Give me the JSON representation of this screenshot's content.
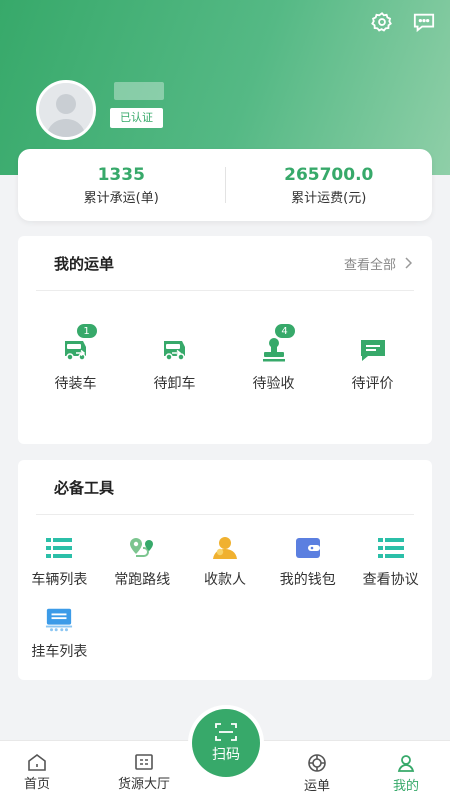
{
  "header": {
    "verified_label": "已认证"
  },
  "stats": {
    "shipments_value": "1335",
    "shipments_label": "累计承运(单)",
    "freight_value": "265700.0",
    "freight_label": "累计运费(元)"
  },
  "orders": {
    "title": "我的运单",
    "view_all": "查看全部",
    "items": [
      {
        "label": "待装车",
        "badge": "1",
        "icon": "truck-loading-icon"
      },
      {
        "label": "待卸车",
        "badge": "",
        "icon": "truck-unloading-icon"
      },
      {
        "label": "待验收",
        "badge": "4",
        "icon": "stamp-icon"
      },
      {
        "label": "待评价",
        "badge": "",
        "icon": "comment-icon"
      }
    ]
  },
  "tools": {
    "title": "必备工具",
    "items": [
      {
        "label": "车辆列表",
        "icon": "list-icon"
      },
      {
        "label": "常跑路线",
        "icon": "route-icon"
      },
      {
        "label": "收款人",
        "icon": "payee-icon"
      },
      {
        "label": "我的钱包",
        "icon": "wallet-icon"
      },
      {
        "label": "查看协议",
        "icon": "list-icon"
      },
      {
        "label": "挂车列表",
        "icon": "trailer-icon"
      }
    ]
  },
  "nav": {
    "home": "首页",
    "cargo_hall": "货源大厅",
    "scan": "扫码",
    "waybill": "运单",
    "mine": "我的"
  },
  "colors": {
    "accent": "#37a96a",
    "badge": "#37a96a"
  }
}
